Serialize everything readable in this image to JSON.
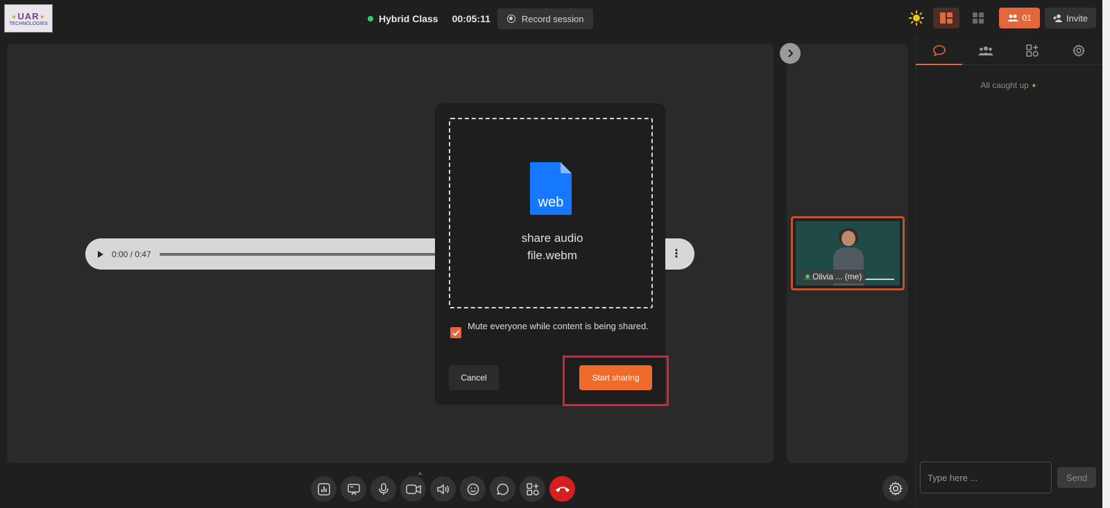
{
  "topbar": {
    "logo_line1": "UAR",
    "logo_line2": "TECHNOLOGIES",
    "class_title": "Hybrid Class",
    "timer": "00:05:11",
    "record_label": "Record session",
    "participant_count": "01",
    "invite_label": "Invite"
  },
  "stage": {
    "audio_time": "0:00 / 0:47"
  },
  "participant_tile": {
    "name": "Olivia ... (me)"
  },
  "right_panel": {
    "caught_up": "All caught up",
    "chat_placeholder": "Type here ...",
    "send_label": "Send"
  },
  "modal": {
    "file_type_badge": "web",
    "file_name_line1": "share audio",
    "file_name_line2": "file.webm",
    "mute_label": "Mute everyone while content is being shared.",
    "mute_checked": true,
    "cancel_label": "Cancel",
    "start_label": "Start sharing"
  },
  "colors": {
    "accent": "#e2673a",
    "highlight": "#e0203a",
    "end_call": "#d61f1f",
    "file_icon": "#1677ff"
  }
}
